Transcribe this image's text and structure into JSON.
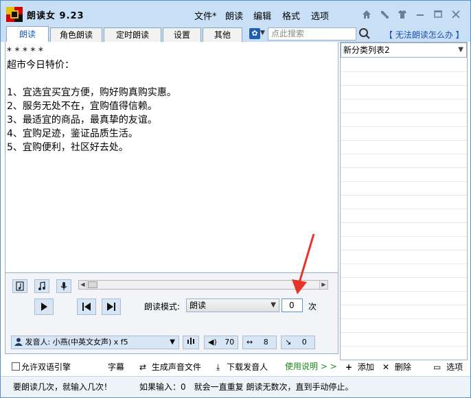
{
  "app": {
    "title": "朗读女 9.23"
  },
  "menu": {
    "file": "文件*",
    "read": "朗读",
    "edit": "编辑",
    "format": "格式",
    "options": "选项"
  },
  "tabs": [
    "朗读",
    "角色朗读",
    "定时朗读",
    "设置",
    "其他"
  ],
  "search": {
    "placeholder": "点此搜索"
  },
  "help_link": "【 无法朗读怎么办 】",
  "content": {
    "text": "* * * * *\n超市今日特价：\n\n1、宜选宜买宜方便，购好购真购实惠。\n2、服务无处不在，宜购值得信赖。\n3、最适宜的商品，最真挚的友谊。\n4、宜购足迹，鉴证品质生活。\n5、宜购便利，社区好去处。"
  },
  "right_panel": {
    "category": "新分类列表2",
    "add": "添加",
    "delete": "删除",
    "options": "选项"
  },
  "controls": {
    "mode_label": "朗读模式:",
    "mode_value": "朗读",
    "count_value": "0",
    "count_unit": "次",
    "speaker": "发音人: 小燕(中英文女声) x f5",
    "volume": "70",
    "speed": "8",
    "pitch": "0"
  },
  "bottom": {
    "dual_engine": "允许双语引擎",
    "subtitle": "字幕",
    "generate_audio": "生成声音文件",
    "download_speaker": "下载发音人",
    "usage": "使用说明 > >"
  },
  "status": {
    "left": "要朗读几次，就输入几次！",
    "right": "如果输入：0　就会一直重复 朗读无数次，直到手动停止。"
  }
}
